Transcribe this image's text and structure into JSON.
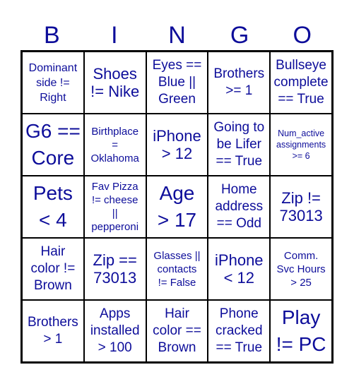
{
  "header": {
    "letters": [
      "B",
      "I",
      "N",
      "G",
      "O"
    ]
  },
  "text_color": "#0d0d9a",
  "grid_color": "#000000",
  "cells": [
    [
      "Dominant\nside !=\nRight",
      "Shoes\n!= Nike",
      "Eyes ==\nBlue ||\nGreen",
      "Brothers\n>= 1",
      "Bullseye\ncomplete\n== True"
    ],
    [
      "G6 ==\nCore",
      "Birthplace\n=\nOklahoma",
      "iPhone\n> 12",
      "Going to\nbe Lifer\n== True",
      "Num_active\nassignments\n>= 6"
    ],
    [
      "Pets\n< 4",
      "Fav Pizza\n!= cheese\n||\npepperoni",
      "Age\n> 17",
      "Home\naddress\n== Odd",
      "Zip !=\n73013"
    ],
    [
      "Hair\ncolor !=\nBrown",
      "Zip ==\n73013",
      "Glasses ||\ncontacts\n!= False",
      "iPhone\n< 12",
      "Comm.\nSvc Hours\n> 25"
    ],
    [
      "Brothers\n> 1",
      "Apps\ninstalled\n> 100",
      "Hair\ncolor ==\nBrown",
      "Phone\ncracked\n== True",
      "Play\n!= PC"
    ]
  ]
}
